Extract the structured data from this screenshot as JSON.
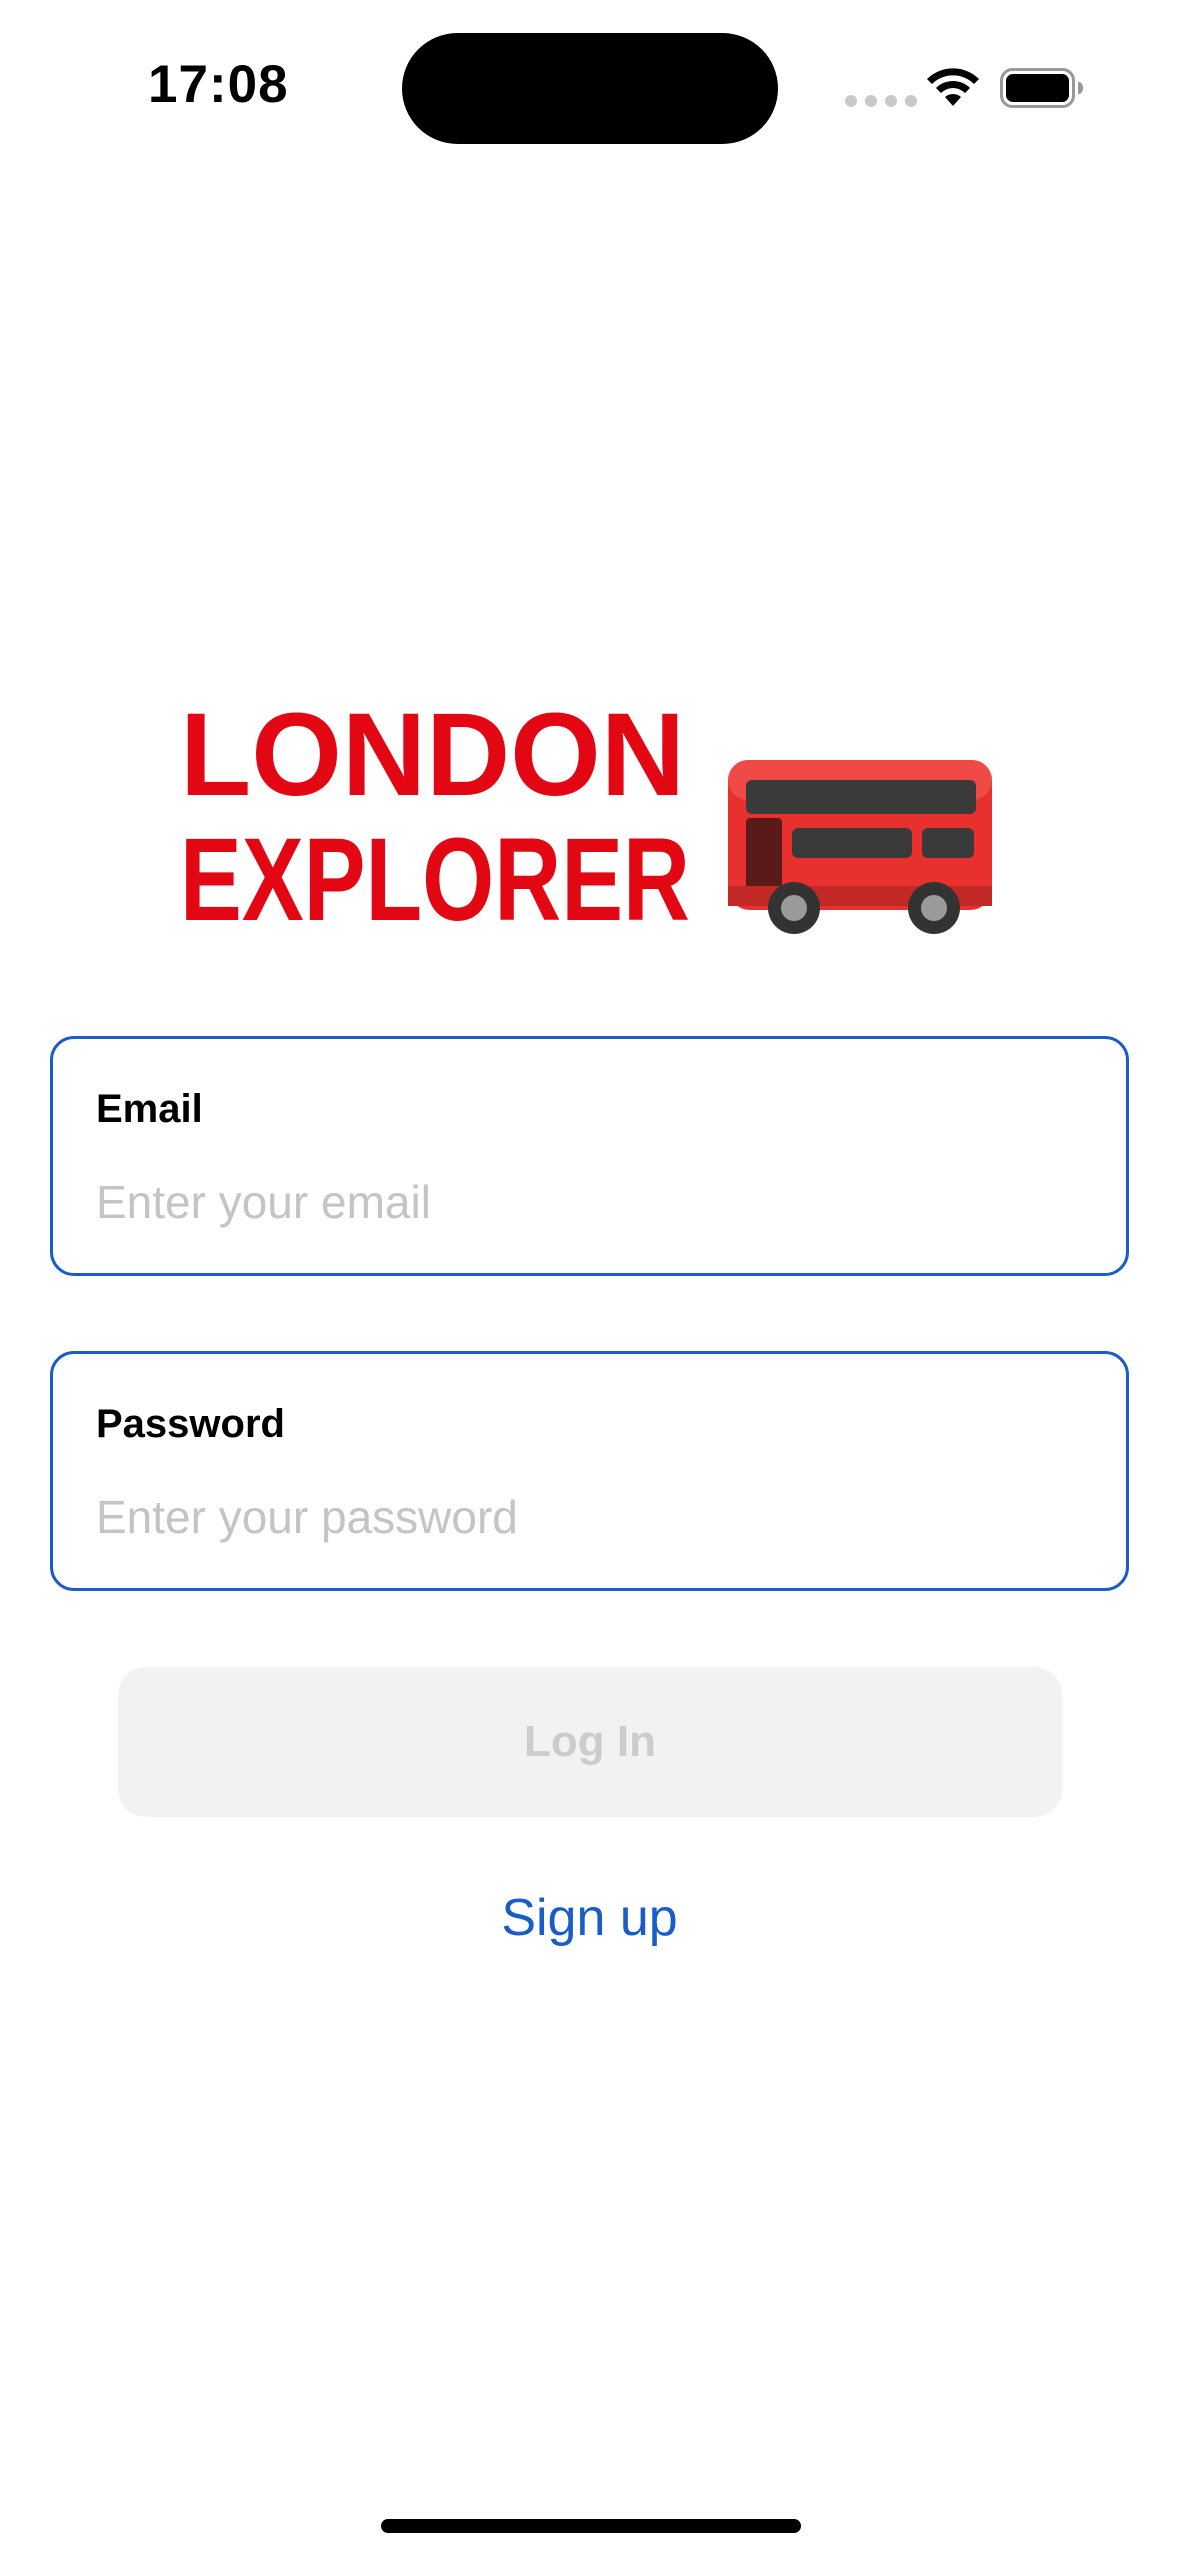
{
  "status_bar": {
    "time": "17:08"
  },
  "logo": {
    "text_line1": "LONDON",
    "text_line2": "EXPLORER",
    "icon": "double-decker-bus-icon",
    "color": "#e30613"
  },
  "form": {
    "email": {
      "label": "Email",
      "placeholder": "Enter your email",
      "value": ""
    },
    "password": {
      "label": "Password",
      "placeholder": "Enter your password",
      "value": ""
    }
  },
  "login_button": {
    "label": "Log In"
  },
  "signup_link": {
    "label": "Sign up"
  },
  "colors": {
    "accent": "#1a5cc8",
    "button_disabled_bg": "#f2f2f2",
    "button_disabled_text": "#cccccc"
  }
}
